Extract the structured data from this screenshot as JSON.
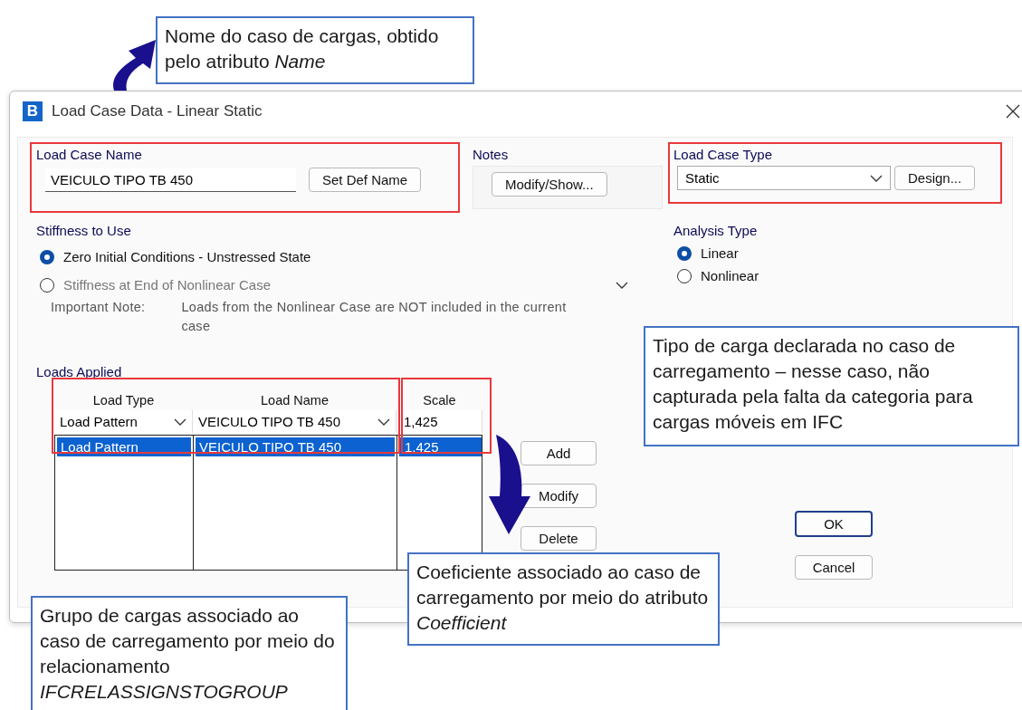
{
  "window": {
    "title": "Load Case Data - Linear Static",
    "icon_letter": "B"
  },
  "load_case_name": {
    "label": "Load Case Name",
    "value": "VEICULO TIPO TB 450",
    "button": "Set Def Name"
  },
  "notes": {
    "label": "Notes",
    "button": "Modify/Show..."
  },
  "load_case_type": {
    "label": "Load Case Type",
    "value": "Static",
    "button": "Design..."
  },
  "stiffness": {
    "label": "Stiffness to Use",
    "options": [
      {
        "label": "Zero Initial Conditions - Unstressed State",
        "selected": true,
        "disabled": false
      },
      {
        "label": "Stiffness at End of Nonlinear Case",
        "selected": false,
        "disabled": true
      }
    ],
    "note_label": "Important Note:",
    "note_text": "Loads from the Nonlinear Case are NOT included in the current case"
  },
  "analysis_type": {
    "label": "Analysis Type",
    "options": [
      {
        "label": "Linear",
        "selected": true
      },
      {
        "label": "Nonlinear",
        "selected": false
      }
    ]
  },
  "loads_applied": {
    "label": "Loads Applied",
    "columns": [
      "Load Type",
      "Load Name",
      "Scale"
    ],
    "editor": {
      "load_type": "Load Pattern",
      "load_name": "VEICULO TIPO TB 450",
      "scale": "1,425"
    },
    "rows": [
      {
        "load_type": "Load Pattern",
        "load_name": "VEICULO TIPO TB 450",
        "scale": "1,425",
        "selected": true
      }
    ],
    "buttons": [
      "Add",
      "Modify",
      "Delete"
    ]
  },
  "dialog_buttons": [
    {
      "label": "OK",
      "default": true
    },
    {
      "label": "Cancel",
      "default": false
    }
  ],
  "annotations": [
    {
      "text": "Nome do caso de cargas, obtido pelo atributo *Name*"
    },
    {
      "text": "Tipo de carga declarada no caso de carregamento – nesse caso, não capturada pela falta da categoria para cargas móveis em IFC"
    },
    {
      "text": "Coeficiente associado ao caso de carregamento por meio do atributo *Coefficient*"
    },
    {
      "text": "Grupo de cargas associado ao caso de carregamento por meio do relacionamento *IFCRELASSIGNSTOGROUP*"
    }
  ]
}
